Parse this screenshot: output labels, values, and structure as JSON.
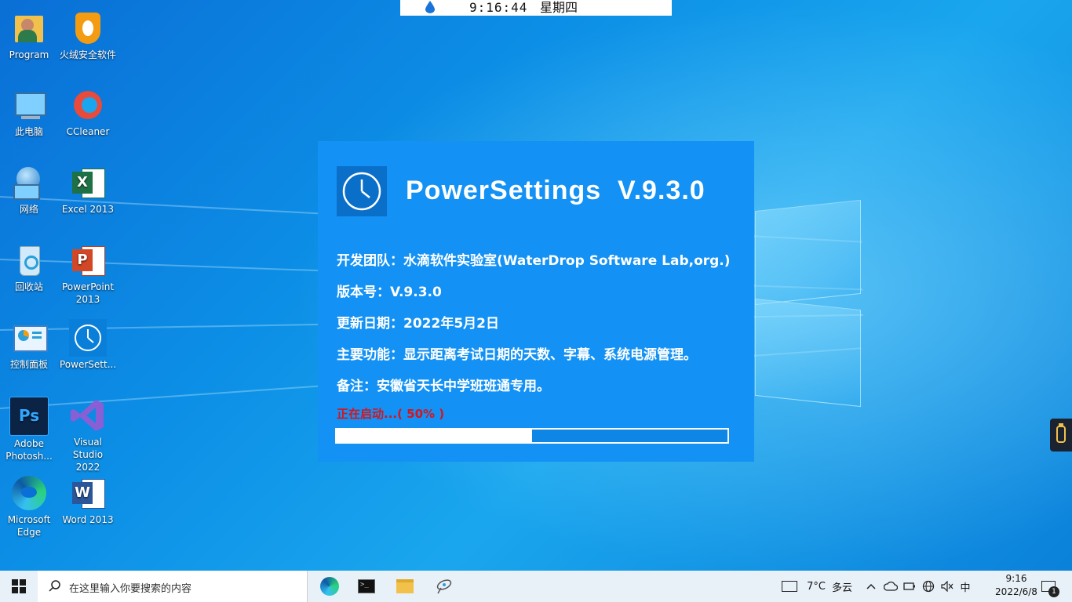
{
  "top_clock": {
    "time": "9:16:44",
    "day": "星期四"
  },
  "desktop_icons": [
    {
      "label": "Program",
      "icon": "user-folder-icon"
    },
    {
      "label": "火绒安全软件",
      "icon": "huorong-shield-icon"
    },
    {
      "label": "此电脑",
      "icon": "computer-icon"
    },
    {
      "label": "CCleaner",
      "icon": "ccleaner-icon"
    },
    {
      "label": "网络",
      "icon": "network-icon"
    },
    {
      "label": "Excel 2013",
      "icon": "excel-icon"
    },
    {
      "label": "回收站",
      "icon": "recycle-bin-icon"
    },
    {
      "label": "PowerPoint 2013",
      "icon": "powerpoint-icon"
    },
    {
      "label": "控制面板",
      "icon": "control-panel-icon"
    },
    {
      "label": "PowerSett...",
      "icon": "clock-icon"
    },
    {
      "label": "Adobe Photosh...",
      "icon": "photoshop-icon"
    },
    {
      "label": "Visual Studio 2022",
      "icon": "visual-studio-icon"
    },
    {
      "label": "Microsoft Edge",
      "icon": "edge-icon"
    },
    {
      "label": "Word 2013",
      "icon": "word-icon"
    }
  ],
  "splash": {
    "title": "PowerSettings  V.9.3.0",
    "team": "开发团队：水滴软件实验室(WaterDrop Software Lab,org.)",
    "version": "版本号：V.9.3.0",
    "update_date": "更新日期：2022年5月2日",
    "features": "主要功能：显示距离考试日期的天数、字幕、系统电源管理。",
    "note": "备注：安徽省天长中学班班通专用。",
    "status": "正在启动...( 50% )",
    "progress": 0.5,
    "accent": "#1391f4",
    "status_color": "#d8141a"
  },
  "taskbar": {
    "search_placeholder": "在这里输入你要搜索的内容",
    "apps": [
      "edge-icon",
      "terminal-icon",
      "file-explorer-icon",
      "satellite-icon"
    ],
    "weather": {
      "temp": "7°C",
      "condition": "多云"
    },
    "ime": "中",
    "time": "9:16",
    "date": "2022/6/8",
    "notification_count": "1"
  }
}
